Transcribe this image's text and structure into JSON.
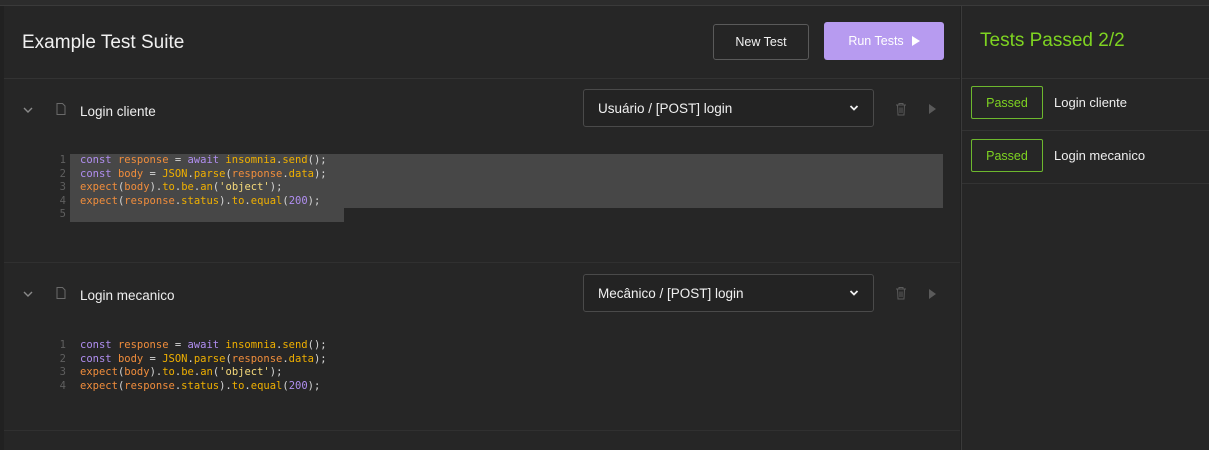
{
  "suite": {
    "title": "Example Test Suite",
    "new_test_label": "New Test",
    "run_tests_label": "Run Tests"
  },
  "tests": [
    {
      "name": "Login cliente",
      "request": "Usuário / [POST] login",
      "code_lines": [
        "const response = await insomnia.send();",
        "const body = JSON.parse(response.data);",
        "expect(body).to.be.an('object');",
        "expect(response.status).to.equal(200);",
        ""
      ],
      "line_numbers": [
        "1",
        "2",
        "3",
        "4",
        "5"
      ]
    },
    {
      "name": "Login mecanico",
      "request": "Mecânico / [POST] login",
      "code_lines": [
        "const response = await insomnia.send();",
        "const body = JSON.parse(response.data);",
        "expect(body).to.be.an('object');",
        "expect(response.status).to.equal(200);"
      ],
      "line_numbers": [
        "1",
        "2",
        "3",
        "4"
      ]
    }
  ],
  "results": {
    "summary": "Tests Passed 2/2",
    "items": [
      {
        "status": "Passed",
        "name": "Login cliente"
      },
      {
        "status": "Passed",
        "name": "Login mecanico"
      }
    ]
  },
  "colors": {
    "accent": "#b79bf0",
    "pass": "#7ed321",
    "background": "#262626"
  },
  "icons": [
    "chevron-down-icon",
    "document-icon",
    "caret-down-icon",
    "trash-icon",
    "play-icon"
  ]
}
